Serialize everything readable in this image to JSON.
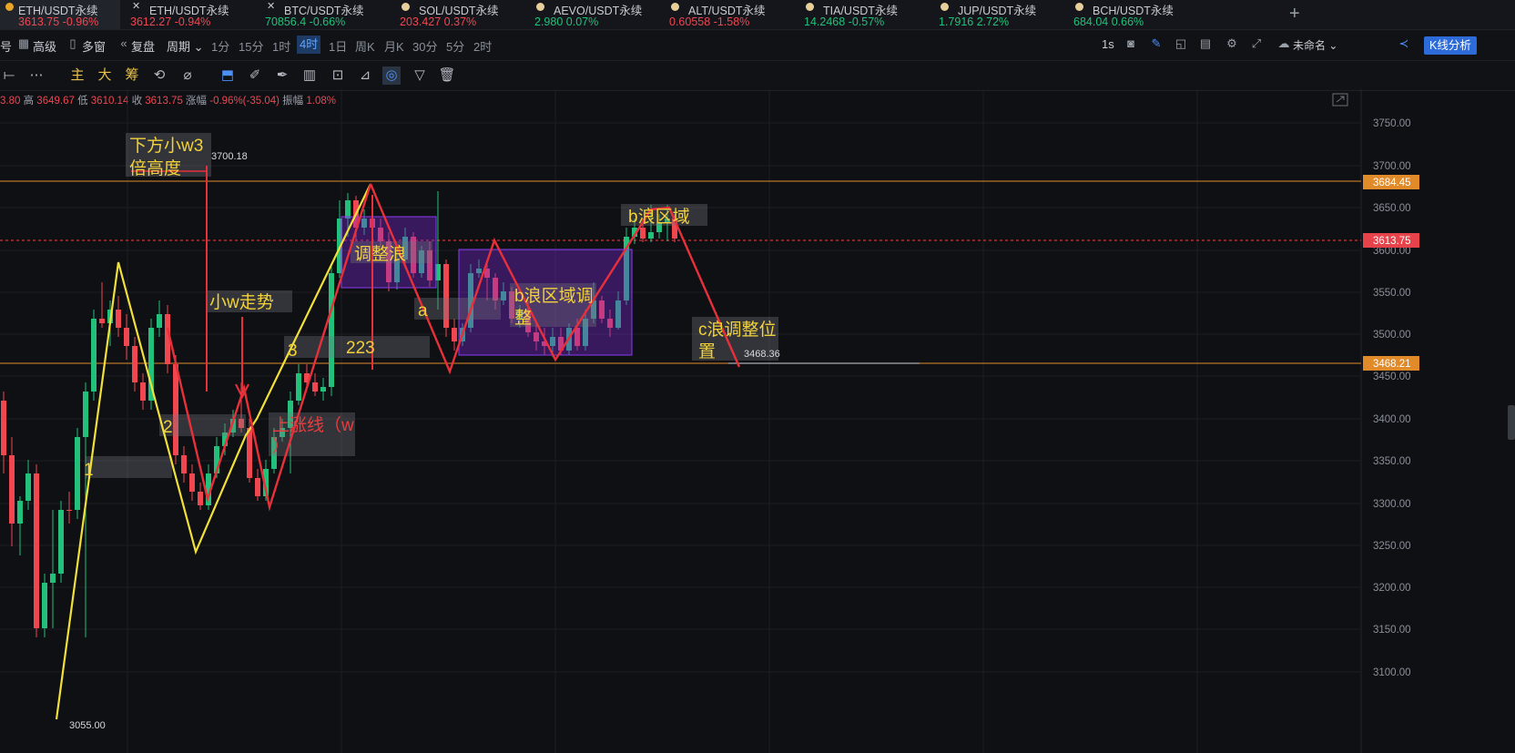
{
  "tickers": [
    {
      "name": "ETH/USDT永续",
      "price": "3613.75",
      "change": "-0.96%",
      "dir": "down",
      "marker": "exchange-logo",
      "active": true
    },
    {
      "name": "ETH/USDT永续",
      "price": "3612.27",
      "change": "-0.94%",
      "dir": "down",
      "marker": "x"
    },
    {
      "name": "BTC/USDT永续",
      "price": "70856.4",
      "change": "-0.66%",
      "dir": "up",
      "marker": "x"
    },
    {
      "name": "SOL/USDT永续",
      "price": "203.427",
      "change": "0.37%",
      "dir": "down",
      "marker": "dot"
    },
    {
      "name": "AEVO/USDT永续",
      "price": "2.980",
      "change": "0.07%",
      "dir": "up",
      "marker": "dot"
    },
    {
      "name": "ALT/USDT永续",
      "price": "0.60558",
      "change": "-1.58%",
      "dir": "down",
      "marker": "dot"
    },
    {
      "name": "TIA/USDT永续",
      "price": "14.2468",
      "change": "-0.57%",
      "dir": "up",
      "marker": "dot"
    },
    {
      "name": "JUP/USDT永续",
      "price": "1.7916",
      "change": "2.72%",
      "dir": "up",
      "marker": "dot"
    },
    {
      "name": "BCH/USDT永续",
      "price": "684.04",
      "change": "0.66%",
      "dir": "up",
      "marker": "dot"
    }
  ],
  "add_tab": "+",
  "toolbar1": {
    "edge": "号",
    "advanced": "高级",
    "multi_window": "多窗",
    "replay": "复盘",
    "period": "周期",
    "intervals": [
      "1分",
      "15分",
      "1时",
      "4时",
      "1日",
      "周K",
      "月K",
      "30分",
      "5分",
      "2时"
    ],
    "selected_interval": "4时",
    "speed": "1s",
    "layout_name": "未命名",
    "kline_btn": "K线分析"
  },
  "toolbar2": {
    "main": "主",
    "big": "大",
    "chip": "筹"
  },
  "ohlc": {
    "open_tail": "3.80",
    "high_label": "高",
    "high": "3649.67",
    "low_label": "低",
    "low": "3610.14",
    "close_label": "收",
    "close": "3613.75",
    "change_label": "涨幅",
    "change": "-0.96%(-35.04)",
    "amp_label": "振幅",
    "amp": "1.08%"
  },
  "axis": {
    "ticks": [
      "3750.00",
      "3700.00",
      "3650.00",
      "3600.00",
      "3550.00",
      "3500.00",
      "3450.00",
      "3400.00",
      "3350.00",
      "3300.00",
      "3250.00",
      "3200.00",
      "3150.00",
      "3100.00"
    ],
    "tag_top": "3684.45",
    "tag_current": "3613.75",
    "tag_bottom": "3468.21"
  },
  "annotations": {
    "wave3_line1": "下方小w3",
    "wave3_line2": "倍高度",
    "wave3_value": "3700.18",
    "small_w": "小w走势",
    "adjust_wave": "调整浪",
    "wave_a": "a",
    "num_223": "223",
    "num_3": "3",
    "num_2": "2",
    "num_1": "1",
    "uptrend_line1": "上涨线（w",
    "uptrend_line2": "）",
    "b_adjust_line1": "b浪区域调",
    "b_adjust_line2": "整",
    "b_region": "b浪区域",
    "c_line1": "c浪调整位",
    "c_line2": "置",
    "c_value": "3468.36",
    "low_value": "3055.00"
  },
  "colors": {
    "up": "#22c07a",
    "down": "#f0464f",
    "accent": "#2d6bd9",
    "annotation": "#f2d23a",
    "orange_line": "#e08a2a",
    "box": "#7b2ad6"
  }
}
